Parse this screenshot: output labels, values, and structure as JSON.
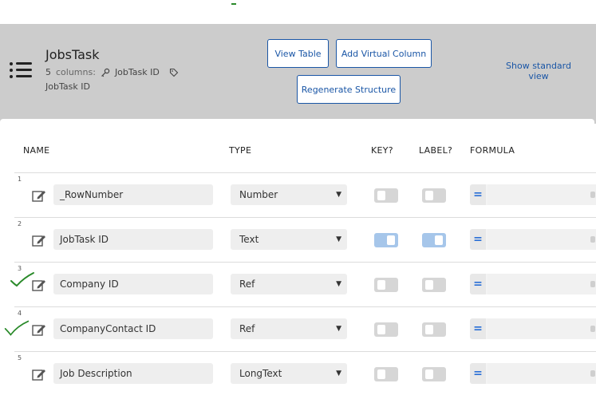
{
  "table": {
    "name": "JobsTask",
    "columns_count": "5",
    "columns_word": "columns:",
    "key_column": "JobTask ID",
    "label_column": "JobTask ID"
  },
  "actions": {
    "view_table": "View Table",
    "add_virtual_column": "Add Virtual Column",
    "regenerate_structure": "Regenerate Structure",
    "show_standard_view": "Show standard view"
  },
  "headers": {
    "name": "NAME",
    "type": "TYPE",
    "key": "KEY?",
    "label": "LABEL?",
    "formula": "FORMULA"
  },
  "rows": [
    {
      "num": "1",
      "name": "_RowNumber",
      "type": "Number",
      "key": false,
      "label": false,
      "formula": ""
    },
    {
      "num": "2",
      "name": "JobTask ID",
      "type": "Text",
      "key": true,
      "label": true,
      "formula": ""
    },
    {
      "num": "3",
      "name": "Company ID",
      "type": "Ref",
      "key": false,
      "label": false,
      "formula": ""
    },
    {
      "num": "4",
      "name": "CompanyContact ID",
      "type": "Ref",
      "key": false,
      "label": false,
      "formula": ""
    },
    {
      "num": "5",
      "name": "Job Description",
      "type": "LongText",
      "key": false,
      "label": false,
      "formula": ""
    }
  ],
  "formula_symbol": "=",
  "colors": {
    "accent": "#1a56a6",
    "header_bg": "#cccccc",
    "toggle_on": "#a6c6ea",
    "annotation_green": "#2a8a2a"
  }
}
